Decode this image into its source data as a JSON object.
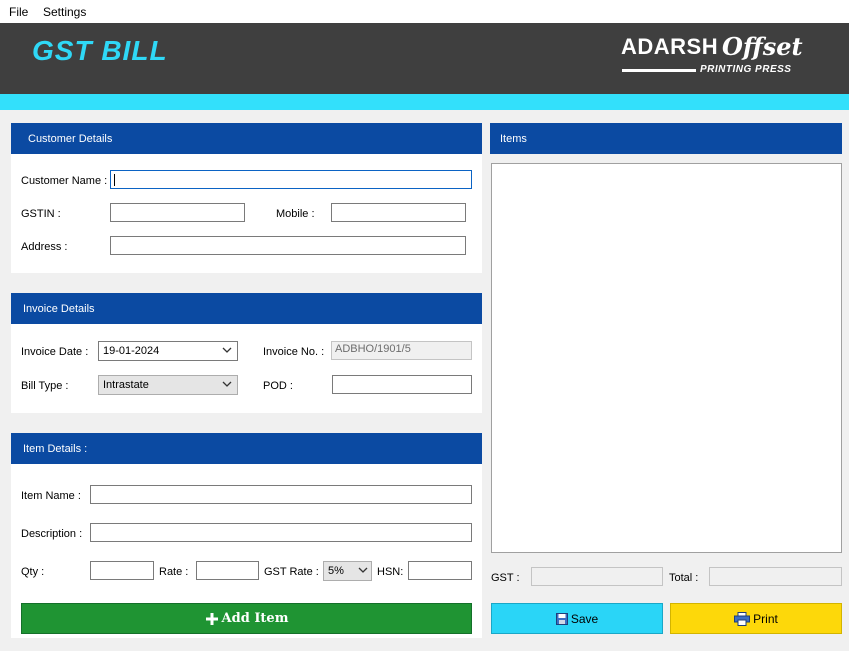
{
  "menu": {
    "file": "File",
    "settings": "Settings"
  },
  "header": {
    "title": "GST BILL",
    "logo_main": "ADARSH",
    "logo_script": "Offset",
    "logo_sub": "PRINTING PRESS"
  },
  "customer": {
    "heading": "Customer Details",
    "name_label": "Customer Name :",
    "name_value": "",
    "gstin_label": "GSTIN :",
    "gstin_value": "",
    "mobile_label": "Mobile :",
    "mobile_value": "",
    "address_label": "Address :",
    "address_value": ""
  },
  "invoice": {
    "heading": "Invoice Details",
    "date_label": "Invoice Date :",
    "date_value": "19-01-2024",
    "number_label": "Invoice No. :",
    "number_value": "ADBHO/1901/5",
    "bill_type_label": "Bill Type :",
    "bill_type_value": "Intrastate",
    "pod_label": "POD :",
    "pod_value": ""
  },
  "item": {
    "heading": "Item Details :",
    "name_label": "Item Name :",
    "description_label": "Description :",
    "qty_label": "Qty :",
    "rate_label": "Rate :",
    "gst_rate_label": "GST Rate :",
    "gst_rate_value": "5%",
    "hsn_label": "HSN:",
    "add_button": "Add Item"
  },
  "items_panel": {
    "heading": "Items",
    "gst_label": "GST :",
    "total_label": "Total :",
    "gst_value": "",
    "total_value": ""
  },
  "actions": {
    "save": "Save",
    "print": "Print"
  },
  "colors": {
    "header_bg": "#3f3f3f",
    "title": "#2fd8f6",
    "accent": "#33e0fb",
    "panel_head": "#0b4aa2",
    "add_button": "#1f9433",
    "save_button": "#2ad5f7",
    "print_button": "#fdd80a"
  },
  "icons": {
    "add": "plus-icon",
    "save": "floppy-disk-icon",
    "print": "printer-icon",
    "dropdown": "chevron-down-icon"
  }
}
